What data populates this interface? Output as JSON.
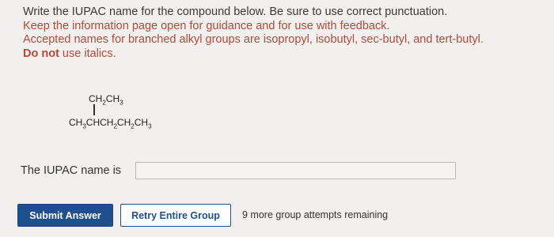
{
  "instructions": {
    "line1": "Write the IUPAC name for the compound below. Be sure to use correct punctuation.",
    "line2": "Keep the information page open for guidance and for use with feedback.",
    "line3": "Accepted names for branched alkyl groups are isopropyl, isobutyl, sec-butyl, and tert-butyl.",
    "line4_bold": "Do not",
    "line4_rest": " use italics."
  },
  "structure": {
    "branch": {
      "a": "CH",
      "a_sub": "2",
      "b": "CH",
      "b_sub": "3"
    },
    "main": {
      "p1": "CH",
      "s1": "3",
      "p2": "CHCH",
      "s2": "2",
      "p3": "CH",
      "s3": "2",
      "p4": "CH",
      "s4": "3"
    }
  },
  "answer": {
    "label": "The IUPAC name is",
    "value": ""
  },
  "buttons": {
    "submit": "Submit Answer",
    "retry": "Retry Entire Group"
  },
  "attempts_text": "9 more group attempts remaining",
  "colors": {
    "accent_blue": "#1f4f8f",
    "instruction_red": "#b5483a",
    "background": "#f1f0ee"
  }
}
